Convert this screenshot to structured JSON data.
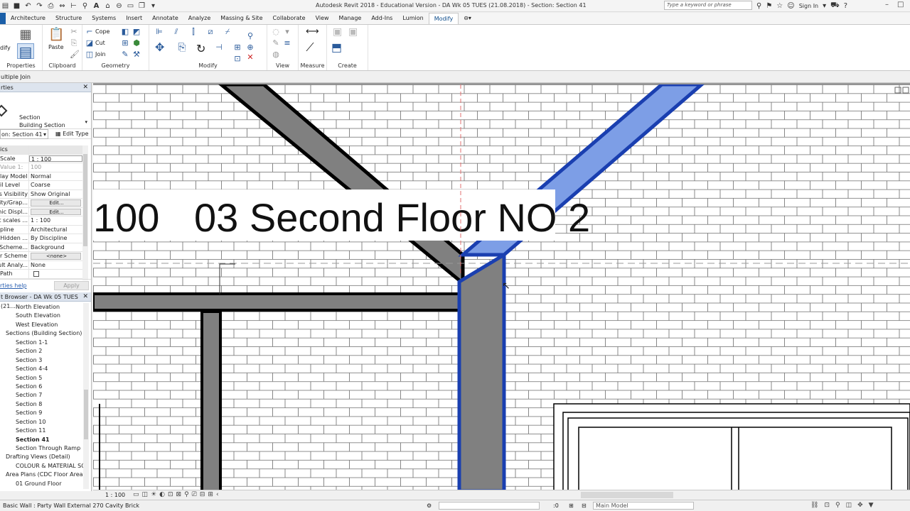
{
  "window": {
    "title": "Autodesk Revit 2018 - Educational Version -   DA Wk 05 TUES (21.08.2018) - Section: Section 41",
    "search_placeholder": "Type a keyword or phrase",
    "signin": "Sign In"
  },
  "ribbon": {
    "tabs": [
      "Architecture",
      "Structure",
      "Systems",
      "Insert",
      "Annotate",
      "Analyze",
      "Massing & Site",
      "Collaborate",
      "View",
      "Manage",
      "Add-Ins",
      "Lumion",
      "Modify"
    ],
    "active_tab": "Modify",
    "groups": {
      "properties": "Properties",
      "clipboard": "Clipboard",
      "geometry": "Geometry",
      "modify": "Modify",
      "view": "View",
      "measure": "Measure",
      "create": "Create"
    },
    "clipboard": {
      "paste": "Paste"
    },
    "geometry": {
      "cope": "Cope",
      "cut": "Cut",
      "join": "Join"
    },
    "modify_short": "dify"
  },
  "options_bar": {
    "text": "ultiple Join"
  },
  "properties": {
    "header": "rties",
    "type_line1": "Section",
    "type_line2": "Building Section",
    "instance": "on: Section 41",
    "edit_type": "Edit Type",
    "rows": [
      {
        "k": "ics",
        "v": "",
        "kind": "cat"
      },
      {
        "k": "Scale",
        "v": "1 : 100",
        "kind": "box"
      },
      {
        "k": "Value    1:",
        "v": "100",
        "kind": "grey"
      },
      {
        "k": "lay Model",
        "v": "Normal",
        "kind": ""
      },
      {
        "k": "il Level",
        "v": "Coarse",
        "kind": ""
      },
      {
        "k": "s Visibility",
        "v": "Show Original",
        "kind": ""
      },
      {
        "k": "ility/Grap...",
        "v": "Edit...",
        "kind": "btn"
      },
      {
        "k": "hic Displ...",
        "v": "Edit...",
        "kind": "btn"
      },
      {
        "k": "at scales ...",
        "v": "1 : 100",
        "kind": ""
      },
      {
        "k": "pline",
        "v": "Architectural",
        "kind": ""
      },
      {
        "k": "w Hidden ...",
        "v": "By Discipline",
        "kind": ""
      },
      {
        "k": "r Scheme...",
        "v": "Background",
        "kind": ""
      },
      {
        "k": "r Scheme",
        "v": "<none>",
        "kind": "btn"
      },
      {
        "k": "ult Analy...",
        "v": "None",
        "kind": ""
      },
      {
        "k": "Path",
        "v": "",
        "kind": "check"
      }
    ],
    "help": "rties help",
    "apply": "Apply"
  },
  "browser": {
    "header": "t Browser - DA Wk 05 TUES (21....",
    "items": [
      {
        "label": "North Elevation",
        "level": 2
      },
      {
        "label": "South Elevation",
        "level": 2
      },
      {
        "label": "West Elevation",
        "level": 2
      },
      {
        "label": "Sections (Building Section)",
        "level": 1
      },
      {
        "label": "Section 1-1",
        "level": 2
      },
      {
        "label": "Section 2",
        "level": 2
      },
      {
        "label": "Section 3",
        "level": 2
      },
      {
        "label": "Section 4-4",
        "level": 2
      },
      {
        "label": "Section 5",
        "level": 2
      },
      {
        "label": "Section 6",
        "level": 2
      },
      {
        "label": "Section 7",
        "level": 2
      },
      {
        "label": "Section 8",
        "level": 2
      },
      {
        "label": "Section 9",
        "level": 2
      },
      {
        "label": "Section 10",
        "level": 2
      },
      {
        "label": "Section 11",
        "level": 2
      },
      {
        "label": "Section 41",
        "level": 2,
        "bold": true
      },
      {
        "label": "Section Through Ramp",
        "level": 2
      },
      {
        "label": "Drafting Views (Detail)",
        "level": 1
      },
      {
        "label": "COLOUR & MATERIAL SCH",
        "level": 2
      },
      {
        "label": "Area Plans (CDC Floor Area)",
        "level": 1
      },
      {
        "label": "01 Ground Floor",
        "level": 2
      }
    ]
  },
  "canvas": {
    "level_label_left": "100",
    "level_label": "03 Second Floor NO 2",
    "colors": {
      "selected": "#1a3fb0",
      "selected_fill": "#7d9ee6",
      "element": "#808080"
    }
  },
  "view_control": {
    "scale": "1 : 100"
  },
  "status": {
    "message": "Basic Wall : Party Wall   External 270 Cavity Brick",
    "coord": ":0",
    "model": "Main Model"
  }
}
